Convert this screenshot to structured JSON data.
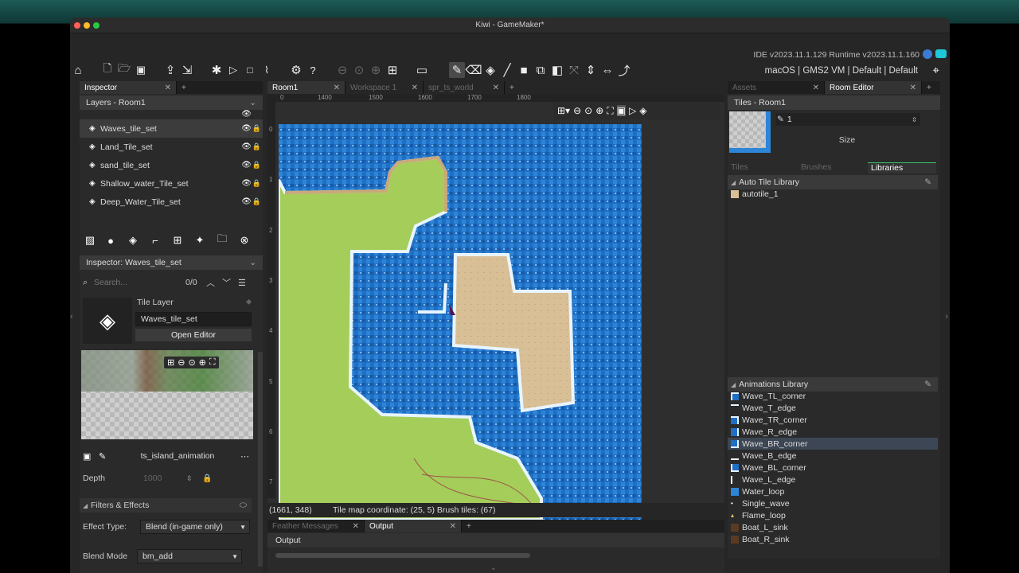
{
  "window": {
    "title": "Kiwi - GameMaker*"
  },
  "ide": {
    "info": "IDE v2023.11.1.129  Runtime v2023.11.1.160",
    "target": "macOS | GMS2 VM | Default | Default"
  },
  "left": {
    "tab": "Inspector",
    "layers_header": "Layers - Room1",
    "layers": [
      "Waves_tile_set",
      "Land_Tile_set",
      "sand_tile_set",
      "Shallow_water_Tile_set",
      "Deep_Water_Tile_set"
    ],
    "inspector_header": "Inspector: Waves_tile_set",
    "search_placeholder": "Search...",
    "search_count": "0/0",
    "tile_layer_label": "Tile Layer",
    "layer_name": "Waves_tile_set",
    "open_editor": "Open Editor",
    "tileset_name": "ts_island_animation",
    "depth_label": "Depth",
    "depth_value": "1000",
    "filters_label": "Filters & Effects",
    "effect_type_label": "Effect Type:",
    "effect_type_value": "Blend (in-game only)",
    "blend_mode_label": "Blend Mode",
    "blend_mode_value": "bm_add"
  },
  "center": {
    "tabs": [
      {
        "label": "Room1",
        "state": "active"
      },
      {
        "label": "Workspace 1",
        "state": "inactive"
      },
      {
        "label": "spr_ts_world",
        "state": "inactive"
      }
    ],
    "ruler_top": [
      "0",
      "1400",
      "1500",
      "1600",
      "1700",
      "1800"
    ],
    "ruler_left": [
      "0",
      "1",
      "2",
      "3",
      "4",
      "5",
      "6",
      "7"
    ],
    "status_coords": "(1661, 348)",
    "status_info": "Tile map coordinate: (25, 5) Brush tiles: (67)",
    "bottom_tabs": [
      {
        "label": "Feather Messages",
        "state": "inactive"
      },
      {
        "label": "Output",
        "state": "active"
      }
    ],
    "output_label": "Output"
  },
  "right": {
    "tabs": [
      {
        "label": "Assets",
        "state": "inactive"
      },
      {
        "label": "Room Editor",
        "state": "active"
      }
    ],
    "tiles_header": "Tiles - Room1",
    "brush_size_value": "1",
    "size_label": "Size",
    "subtabs": [
      "Tiles",
      "Brushes",
      "Libraries"
    ],
    "auto_tile_header": "Auto Tile Library",
    "auto_tiles": [
      "autotile_1"
    ],
    "anim_header": "Animations Library",
    "animations": [
      "Wave_TL_corner",
      "Wave_T_edge",
      "Wave_TR_corner",
      "Wave_R_edge",
      "Wave_BR_corner",
      "Wave_B_edge",
      "Wave_BL_corner",
      "Wave_L_edge",
      "Water_loop",
      "Single_wave",
      "Flame_loop",
      "Boat_L_sink",
      "Boat_R_sink"
    ],
    "selected_animation": "Wave_BR_corner"
  },
  "colors": {
    "water": "#1f6fc4",
    "grass": "#a4cd5a",
    "sand": "#d8bf95",
    "foam": "#e8f4ff",
    "accent": "#4a9df0"
  }
}
